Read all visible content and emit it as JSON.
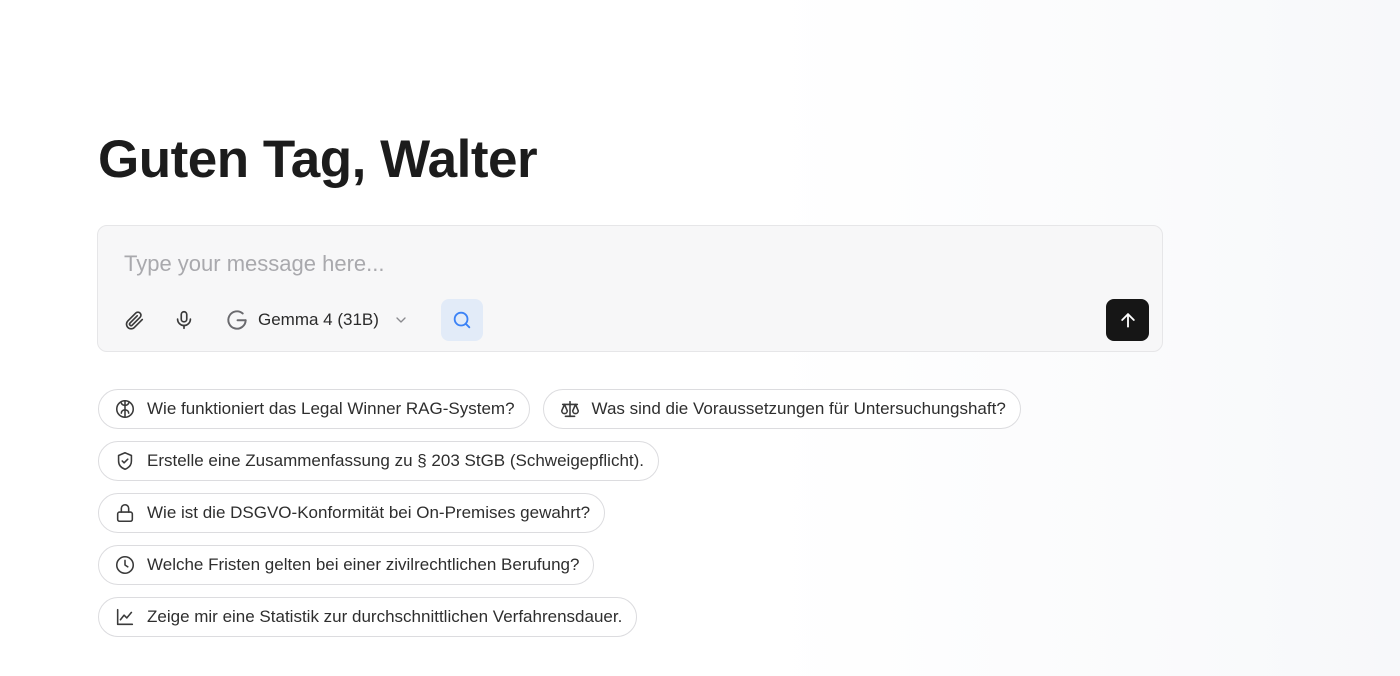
{
  "greeting": "Guten Tag, Walter",
  "composer": {
    "placeholder": "Type your message here...",
    "model_label": "Gemma 4 (31B)",
    "attach_icon": "paperclip-icon",
    "mic_icon": "microphone-icon",
    "model_icon": "google-g-icon",
    "search_icon": "search-icon",
    "send_icon": "arrow-up-icon",
    "search_active_color": "#e2ebf8",
    "send_color": "#161616"
  },
  "suggestions": [
    {
      "label": "Wie funktioniert das Legal Winner RAG-System?",
      "icon": "brain-icon"
    },
    {
      "label": "Was sind die Voraussetzungen für Untersuchungshaft?",
      "icon": "scales-icon"
    },
    {
      "label": "Erstelle eine Zusammenfassung zu § 203 StGB (Schweigepflicht).",
      "icon": "shield-check-icon"
    },
    {
      "label": "Wie ist die DSGVO-Konformität bei On-Premises gewahrt?",
      "icon": "lock-icon"
    },
    {
      "label": "Welche Fristen gelten bei einer zivilrechtlichen Berufung?",
      "icon": "clock-icon"
    },
    {
      "label": "Zeige mir eine Statistik zur durchschnittlichen Verfahrensdauer.",
      "icon": "line-chart-icon"
    }
  ]
}
